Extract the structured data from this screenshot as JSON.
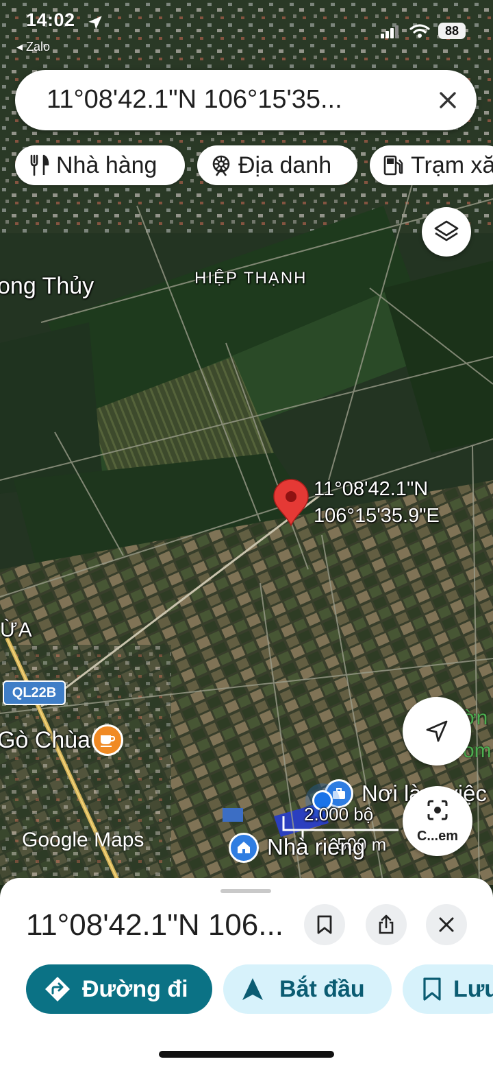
{
  "status_bar": {
    "time": "14:02",
    "back_app": "◂ Zalo",
    "battery": "88"
  },
  "search": {
    "query": "11°08'42.1\"N 106°15'35..."
  },
  "chips": [
    {
      "label": "Nhà hàng",
      "icon": "restaurant-icon"
    },
    {
      "label": "Địa danh",
      "icon": "landmark-icon"
    },
    {
      "label": "Trạm xăng",
      "icon": "gas-station-icon"
    }
  ],
  "map": {
    "labels": {
      "hiep_thanh": "HIỆP THẠNH",
      "long_thuy": "ong Thủy",
      "ua": "ỪA",
      "go_chua": "Gò Chùa",
      "noi_lam_viec": "Nơi làm việc",
      "nha_rieng": "Nhà riêng",
      "right_edge_1": "ờn",
      "right_edge_2": "om",
      "road": "QL22B"
    },
    "pin": {
      "lat": "11°08'42.1\"N",
      "lng": "106°15'35.9\"E"
    },
    "scale": {
      "imperial": "2.000 bộ",
      "metric": "500 m"
    },
    "watermark": "Google Maps",
    "camera_label": "C...em"
  },
  "sheet": {
    "title": "11°08'42.1\"N 106...",
    "actions": [
      {
        "label": "Đường đi",
        "icon": "directions-icon"
      },
      {
        "label": "Bắt đầu",
        "icon": "navigation-arrow-icon"
      },
      {
        "label": "Lưu",
        "icon": "bookmark-icon"
      }
    ]
  },
  "colors": {
    "accent": "#0b7285",
    "pin": "#e53935",
    "light_button": "#d7f2fb",
    "button_text": "#0b5c72"
  }
}
